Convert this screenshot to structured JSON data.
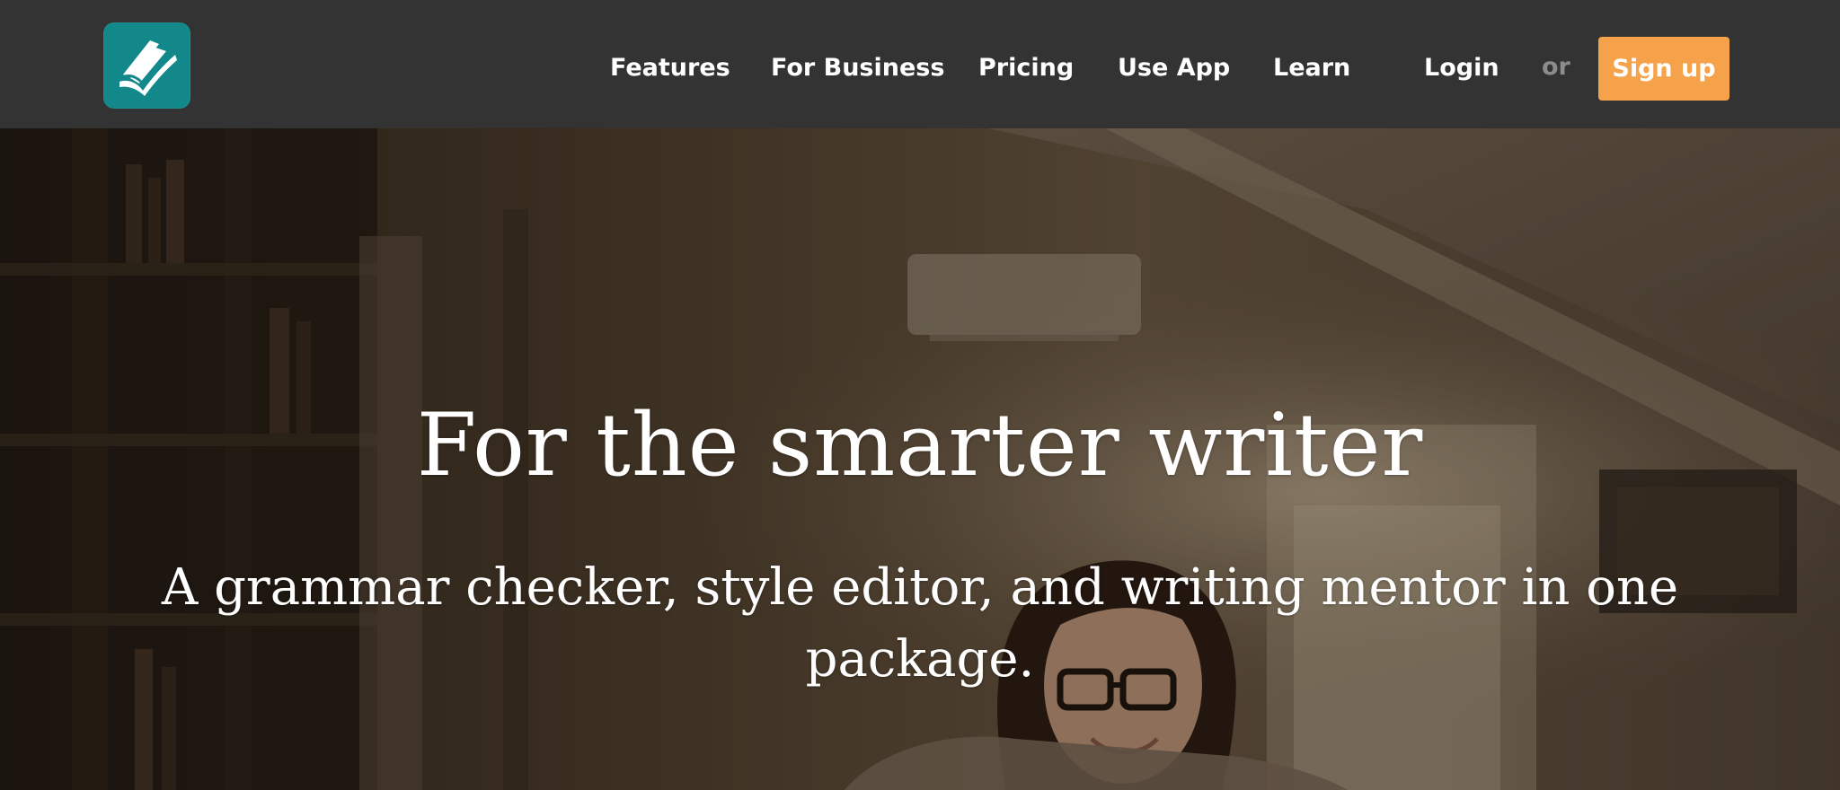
{
  "brand": {
    "logo_icon": "book-check-icon",
    "logo_color": "#12888a"
  },
  "nav": {
    "features": "Features",
    "for_business": "For Business",
    "pricing": "Pricing",
    "use_app": "Use App",
    "learn": "Learn",
    "login": "Login",
    "or": "or",
    "signup": "Sign up"
  },
  "colors": {
    "navbar_bg": "#333333",
    "signup_bg": "#f6a24b",
    "or_text": "#8c8c8c"
  },
  "hero": {
    "title": "For the smarter writer",
    "subtitle": "A grammar checker, style editor, and writing mentor in one package."
  }
}
